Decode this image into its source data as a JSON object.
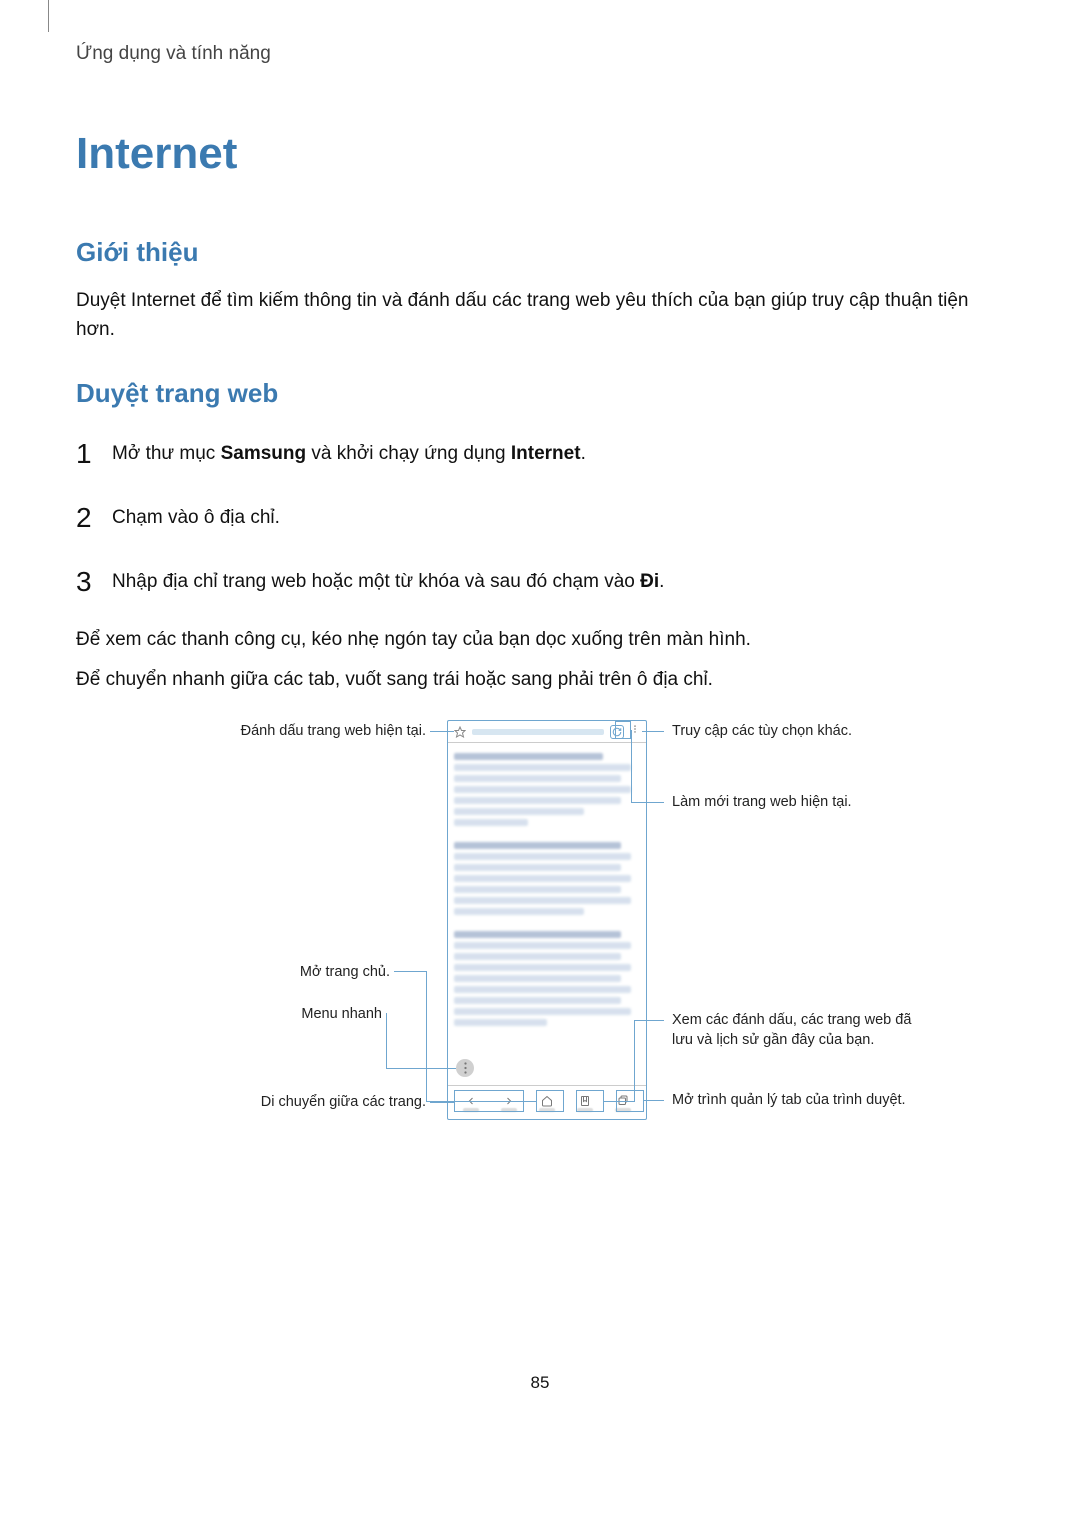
{
  "header": {
    "section": "Ứng dụng và tính năng"
  },
  "title": "Internet",
  "intro": {
    "heading": "Giới thiệu",
    "text": "Duyệt Internet để tìm kiếm thông tin và đánh dấu các trang web yêu thích của bạn giúp truy cập thuận tiện hơn."
  },
  "browse": {
    "heading": "Duyệt trang web",
    "steps": {
      "s1_pre": "Mở thư mục ",
      "s1_b1": "Samsung",
      "s1_mid": " và khởi chạy ứng dụng ",
      "s1_b2": "Internet",
      "s1_post": ".",
      "s2": "Chạm vào ô địa chỉ.",
      "s3_pre": "Nhập địa chỉ trang web hoặc một từ khóa và sau đó chạm vào ",
      "s3_b1": "Đi",
      "s3_post": "."
    },
    "para1": "Để xem các thanh công cụ, kéo nhẹ ngón tay của bạn dọc xuống trên màn hình.",
    "para2": "Để chuyển nhanh giữa các tab, vuốt sang trái hoặc sang phải trên ô địa chỉ."
  },
  "callouts": {
    "c1": "Đánh dấu trang web hiện tại.",
    "c2": "Mở trang chủ.",
    "c3": "Menu nhanh",
    "c4": "Di chuyển giữa các trang.",
    "c5": "Truy cập các tùy chọn khác.",
    "c6": "Làm mới trang web hiện tại.",
    "c7": "Xem các đánh dấu, các trang web đã lưu và lịch sử gần đây của bạn.",
    "c8": "Mở trình quản lý tab của trình duyệt."
  },
  "page_number": "85"
}
